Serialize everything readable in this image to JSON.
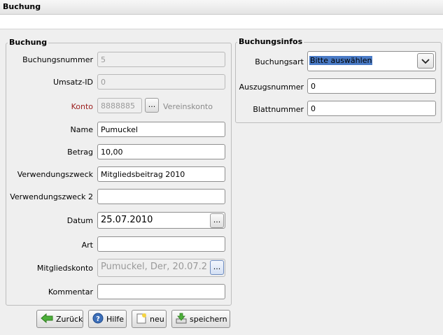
{
  "window": {
    "title": "Buchung"
  },
  "left_group": {
    "title": "Buchung",
    "fields": {
      "buchungsnummer": {
        "label": "Buchungsnummer",
        "value": "5"
      },
      "umsatz_id": {
        "label": "Umsatz-ID",
        "value": "0"
      },
      "konto": {
        "label": "Konto",
        "value": "8888885",
        "button": "...",
        "note": "Vereinskonto"
      },
      "name": {
        "label": "Name",
        "value": "Pumuckel"
      },
      "betrag": {
        "label": "Betrag",
        "value": "10,00"
      },
      "verwendungszweck": {
        "label": "Verwendungszweck",
        "value": "Mitgliedsbeitrag 2010"
      },
      "verwendungszweck2": {
        "label": "Verwendungszweck 2",
        "value": ""
      },
      "datum": {
        "label": "Datum",
        "value": "25.07.2010",
        "button": "..."
      },
      "art": {
        "label": "Art",
        "value": ""
      },
      "mitgliedskonto": {
        "label": "Mitgliedskonto",
        "value": "Pumuckel,  Der, 20.07.2",
        "button": "..."
      },
      "kommentar": {
        "label": "Kommentar",
        "value": ""
      }
    }
  },
  "right_group": {
    "title": "Buchungsinfos",
    "fields": {
      "buchungsart": {
        "label": "Buchungsart",
        "value": "Bitte auswählen"
      },
      "auszugsnummer": {
        "label": "Auszugsnummer",
        "value": "0"
      },
      "blattnummer": {
        "label": "Blattnummer",
        "value": "0"
      }
    }
  },
  "buttons": {
    "zurueck": "Zurück",
    "hilfe": "Hilfe",
    "neu": "neu",
    "speichern": "speichern"
  },
  "colors": {
    "selection": "#4a7bc6",
    "konto_label": "#9c1f1f"
  },
  "icons": {
    "zurueck": "arrow-left-icon",
    "hilfe": "help-icon",
    "neu": "new-document-icon",
    "speichern": "save-icon",
    "dropdown": "chevron-down-icon"
  }
}
